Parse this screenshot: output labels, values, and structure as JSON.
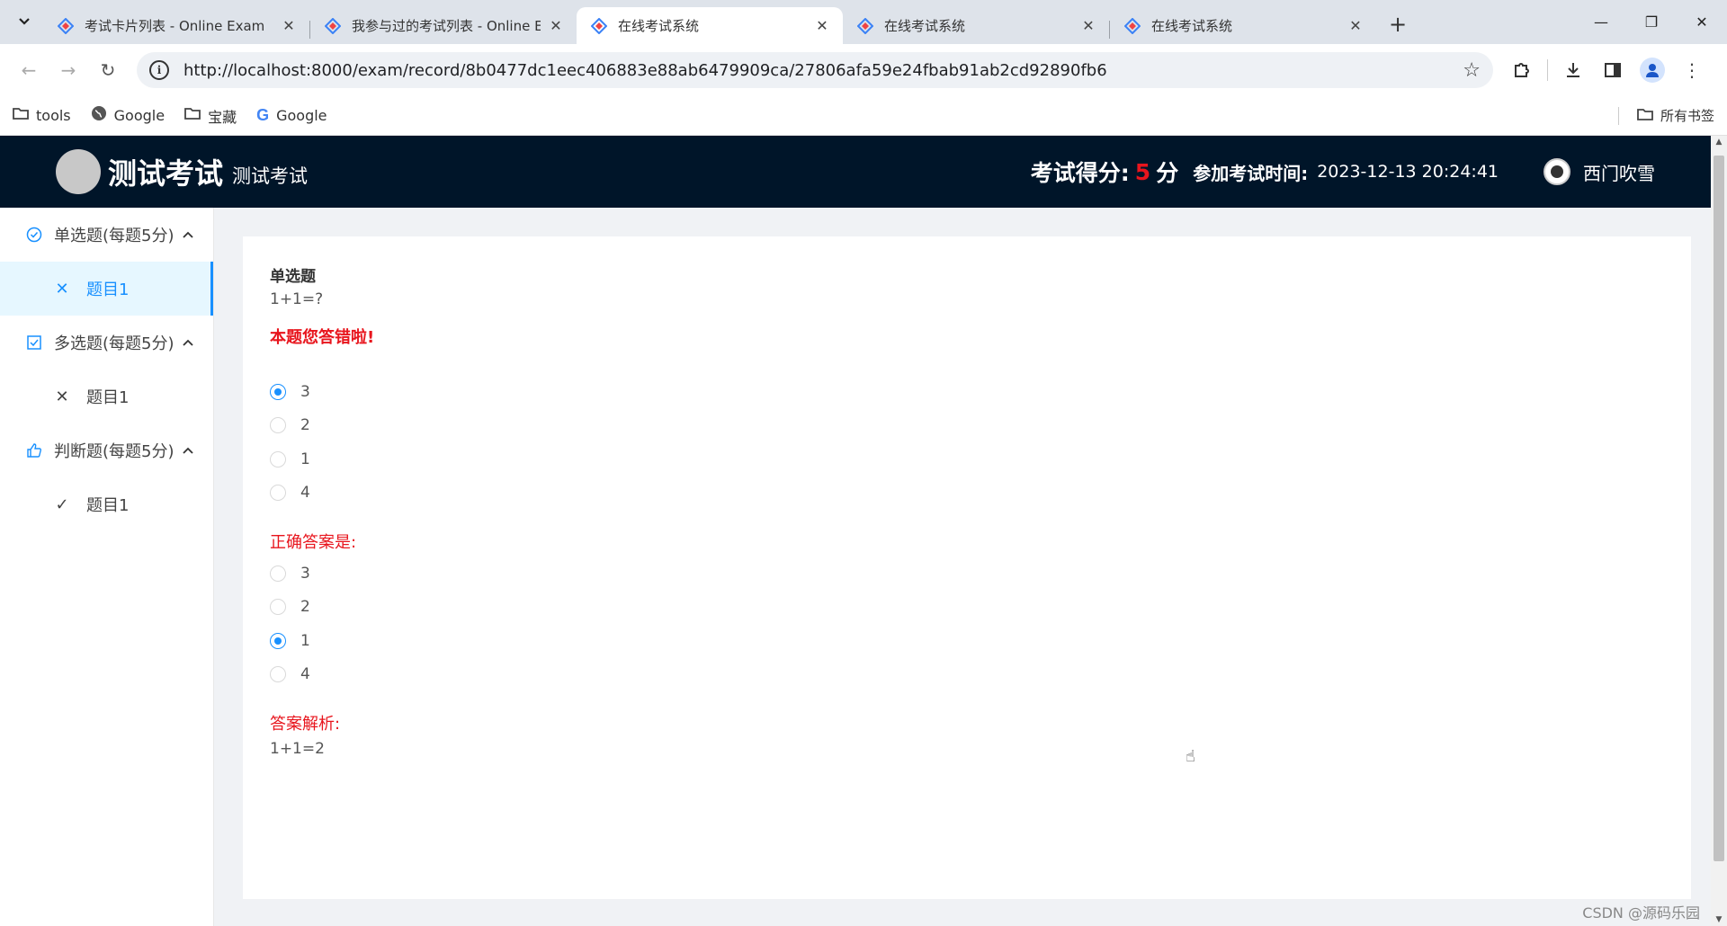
{
  "browser": {
    "tabs": [
      {
        "title": "考试卡片列表 - Online Exam",
        "active": false
      },
      {
        "title": "我参与过的考试列表 - Online E",
        "active": false
      },
      {
        "title": "在线考试系统",
        "active": true
      },
      {
        "title": "在线考试系统",
        "active": false
      },
      {
        "title": "在线考试系统",
        "active": false
      }
    ],
    "url": "http://localhost:8000/exam/record/8b0477dc1eec406883e88ab6479909ca/27806afa59e24fbab91ab2cd92890fb6",
    "bookmarks": [
      {
        "label": "tools",
        "icon": "folder-icon"
      },
      {
        "label": "Google",
        "icon": "globe-icon"
      },
      {
        "label": "宝藏",
        "icon": "folder-icon"
      },
      {
        "label": "Google",
        "icon": "google-icon"
      }
    ],
    "all_bookmarks": "所有书签"
  },
  "header": {
    "brand": "测试考试",
    "brand_sub": "测试考试",
    "score_label": "考试得分:",
    "score_value": "5",
    "score_unit": "分",
    "time_label": "参加考试时间:",
    "time_value": "2023-12-13 20:24:41",
    "user_name": "西门吹雪"
  },
  "sidebar": {
    "groups": [
      {
        "label": "单选题(每题5分)",
        "icon": "check-circle-icon",
        "items": [
          {
            "label": "题目1",
            "status": "wrong",
            "selected": true
          }
        ]
      },
      {
        "label": "多选题(每题5分)",
        "icon": "check-square-icon",
        "items": [
          {
            "label": "题目1",
            "status": "wrong",
            "selected": false
          }
        ]
      },
      {
        "label": "判断题(每题5分)",
        "icon": "thumbs-up-icon",
        "items": [
          {
            "label": "题目1",
            "status": "correct",
            "selected": false
          }
        ]
      }
    ]
  },
  "question": {
    "type": "单选题",
    "text": "1+1=?",
    "wrong_notice": "本题您答错啦!",
    "user_options": [
      {
        "label": "3",
        "checked": true
      },
      {
        "label": "2",
        "checked": false
      },
      {
        "label": "1",
        "checked": false
      },
      {
        "label": "4",
        "checked": false
      }
    ],
    "correct_label": "正确答案是:",
    "correct_options": [
      {
        "label": "3",
        "checked": false
      },
      {
        "label": "2",
        "checked": false
      },
      {
        "label": "1",
        "checked": true
      },
      {
        "label": "4",
        "checked": false
      }
    ],
    "analysis_label": "答案解析:",
    "analysis_text": "1+1=2"
  },
  "watermark": "CSDN @源码乐园",
  "colors": {
    "header_bg": "#001529",
    "accent": "#1890ff",
    "error": "#e8151d"
  }
}
